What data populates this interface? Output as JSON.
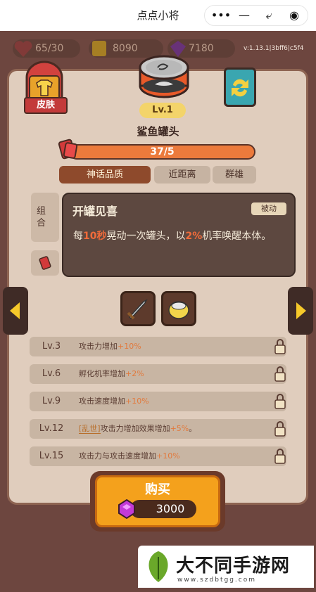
{
  "miniprogram": {
    "title": "点点小将",
    "capsule": {
      "more": "•••",
      "minimize": "—",
      "share": "⤶",
      "close": "◉"
    }
  },
  "stats": {
    "hearts": "65/30",
    "coins": "8090",
    "gems": "7180",
    "version": "v:1.13.1|3bff6|c5f4"
  },
  "skin_button": {
    "label": "皮肤"
  },
  "item": {
    "level": "Lv.1",
    "name": "鲨鱼罐头",
    "progress_text": "37/5",
    "progress_fraction": 1.0,
    "tags": [
      "神话品质",
      "近距离",
      "群雄"
    ]
  },
  "side_tabs": {
    "combo": "组合"
  },
  "tooltip": {
    "title": "开罐见喜",
    "badge": "被动",
    "desc_prefix": "每",
    "desc_hl1": "10秒",
    "desc_mid": "晃动一次罐头，以",
    "desc_hl2": "2%",
    "desc_suffix": "机率唤醒本体。"
  },
  "levels": [
    {
      "lv": "Lv.3",
      "desc": "攻击力增加",
      "plus": "+10%"
    },
    {
      "lv": "Lv.6",
      "desc": "孵化机率增加",
      "plus": "+2%"
    },
    {
      "lv": "Lv.9",
      "desc": "攻击速度增加",
      "plus": "+10%"
    },
    {
      "lv": "Lv.12",
      "tag": "[乱世]",
      "desc": "攻击力增加效果增加",
      "plus": "+5%",
      "end": "。"
    },
    {
      "lv": "Lv.15",
      "desc": "攻击力与攻击速度增加",
      "plus": "+10%"
    }
  ],
  "buy": {
    "label": "购买",
    "price": "3000"
  },
  "watermark": {
    "text": "大不同手游网",
    "url": "www.szdbtgg.com"
  },
  "colors": {
    "accent": "#f4a11c",
    "progress": "#ec7a3c",
    "rarity_tag": "#8e4a2c",
    "highlight": "#f26b3a"
  }
}
